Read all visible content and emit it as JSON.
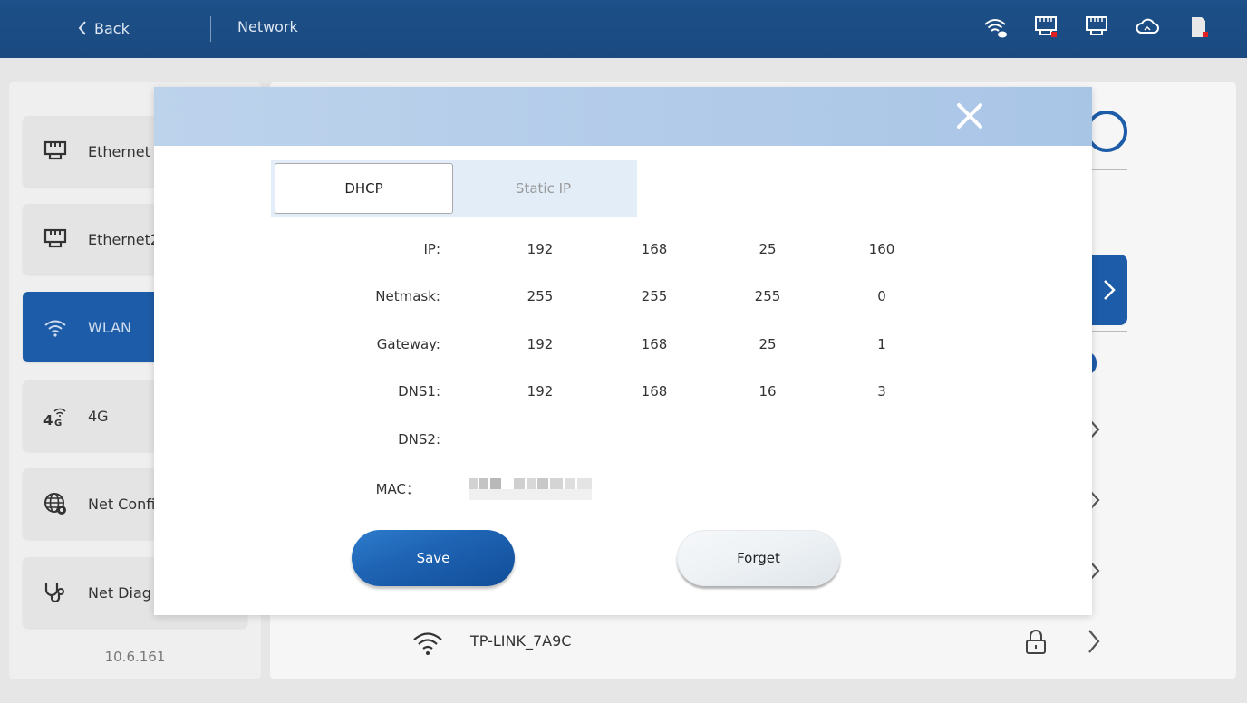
{
  "header": {
    "back_label": "Back",
    "title": "Network",
    "status_icons": [
      "wifi-cloud-icon",
      "ethernet-disconnected-icon",
      "ethernet-icon",
      "cloud-icon",
      "sd-card-icon"
    ]
  },
  "sidebar": {
    "items": [
      {
        "label": "Ethernet",
        "icon": "ethernet-icon"
      },
      {
        "label": "Ethernet2",
        "icon": "ethernet-icon"
      },
      {
        "label": "WLAN",
        "icon": "wifi-icon",
        "active": true
      },
      {
        "label": "4G",
        "icon": "4g-icon"
      },
      {
        "label": "Net Config",
        "icon": "globe-gear-icon"
      },
      {
        "label": "Net Diag",
        "icon": "stethoscope-icon"
      }
    ],
    "version": "10.6.161"
  },
  "main": {
    "wifi_rows": [
      {
        "ssid": "TP-LINK_7A9C",
        "locked": true
      }
    ]
  },
  "dialog": {
    "tabs": {
      "dhcp": "DHCP",
      "static": "Static IP"
    },
    "fields": {
      "ip": {
        "label": "IP:",
        "octets": [
          "192",
          "168",
          "25",
          "160"
        ]
      },
      "netmask": {
        "label": "Netmask:",
        "octets": [
          "255",
          "255",
          "255",
          "0"
        ]
      },
      "gateway": {
        "label": "Gateway:",
        "octets": [
          "192",
          "168",
          "25",
          "1"
        ]
      },
      "dns1": {
        "label": "DNS1:",
        "octets": [
          "192",
          "168",
          "16",
          "3"
        ]
      },
      "dns2": {
        "label": "DNS2:",
        "octets": [
          "",
          "",
          "",
          ""
        ]
      },
      "mac": {
        "label": "MAC："
      }
    },
    "save_label": "Save",
    "forget_label": "Forget"
  },
  "colors": {
    "header_bg": "#1b4c84",
    "accent": "#1d5ca8",
    "dialog_header": "#b3cce9",
    "tab_strip": "#e2edf8"
  }
}
